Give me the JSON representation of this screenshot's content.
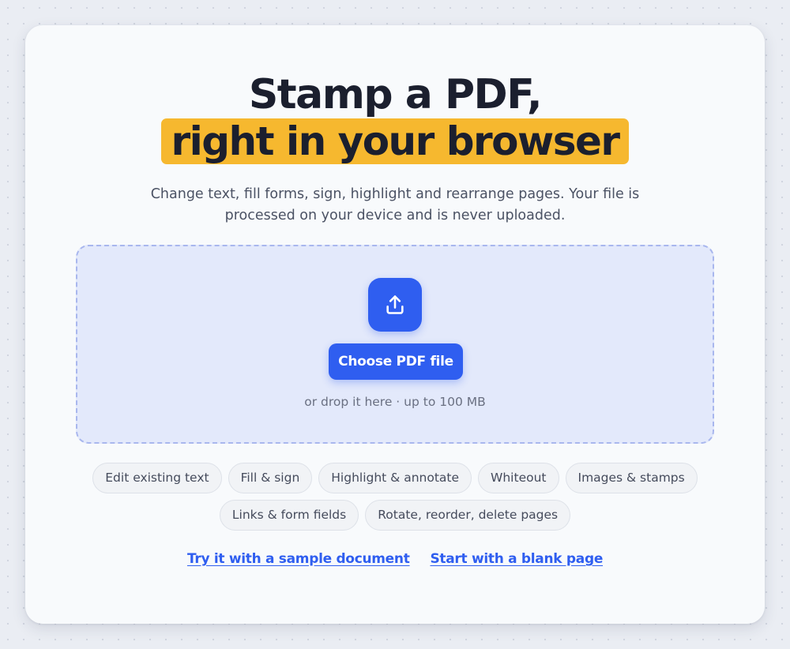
{
  "hero": {
    "title_line1": "Stamp a PDF,",
    "title_line2": "right in your browser",
    "subtitle": "Change text, fill forms, sign, highlight and rearrange pages. Your file is processed on your device and is never uploaded.",
    "highlight_color": "#f6b82f"
  },
  "dropzone": {
    "icon": "upload-icon",
    "button_label": "Choose PDF file",
    "hint": "or drop it here · up to 100 MB",
    "accent_color": "#2f5ef0"
  },
  "features": [
    "Edit existing text",
    "Fill & sign",
    "Highlight & annotate",
    "Whiteout",
    "Images & stamps",
    "Links & form fields",
    "Rotate, reorder, delete pages"
  ],
  "links": {
    "sample": "Try it with a sample document",
    "blank": "Start with a blank page"
  }
}
